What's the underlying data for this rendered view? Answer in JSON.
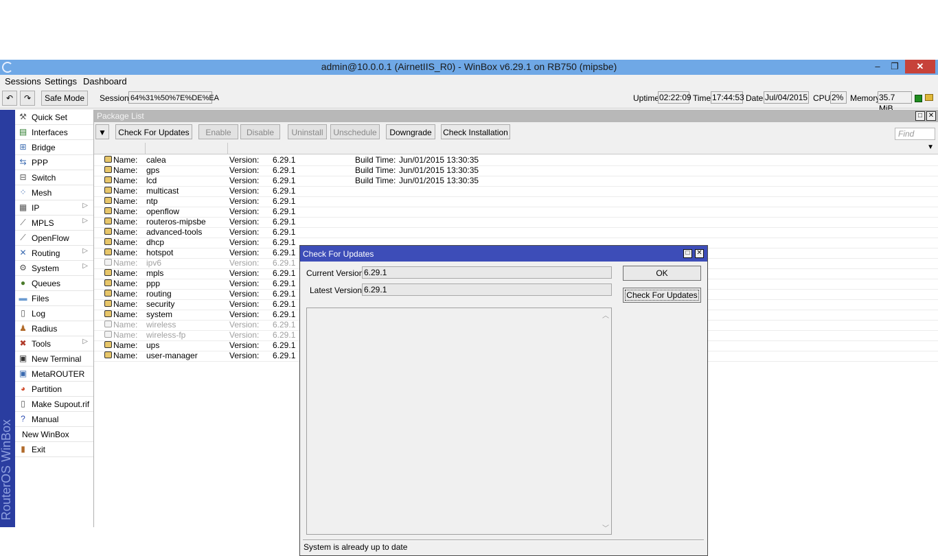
{
  "window": {
    "title": "admin@10.0.0.1 (AirnetIIS_R0) - WinBox v6.29.1 on RB750 (mipsbe)",
    "minimize": "–",
    "maximize": "❐",
    "close": "✕"
  },
  "menu": [
    "Sessions",
    "Settings",
    "Dashboard"
  ],
  "toolbar": {
    "undo": "↶",
    "redo": "↷",
    "safe_mode": "Safe Mode",
    "session_label": "Session:",
    "session_value": "64%31%50%7E%DE%EA",
    "uptime_label": "Uptime:",
    "uptime_value": "02:22:09",
    "time_label": "Time:",
    "time_value": "17:44:53",
    "date_label": "Date:",
    "date_value": "Jul/04/2015",
    "cpu_label": "CPU:",
    "cpu_value": "2%",
    "memory_label": "Memory:",
    "memory_value": "35.7 MiB"
  },
  "sidebar": {
    "brand": "RouterOS WinBox",
    "items": [
      {
        "label": "Quick Set",
        "icon": "quickset-icon"
      },
      {
        "label": "Interfaces",
        "icon": "interfaces-icon"
      },
      {
        "label": "Bridge",
        "icon": "bridge-icon"
      },
      {
        "label": "PPP",
        "icon": "ppp-icon"
      },
      {
        "label": "Switch",
        "icon": "switch-icon"
      },
      {
        "label": "Mesh",
        "icon": "mesh-icon"
      },
      {
        "label": "IP",
        "icon": "ip-icon",
        "submenu": true
      },
      {
        "label": "MPLS",
        "icon": "mpls-icon",
        "submenu": true
      },
      {
        "label": "OpenFlow",
        "icon": "openflow-icon"
      },
      {
        "label": "Routing",
        "icon": "routing-icon",
        "submenu": true
      },
      {
        "label": "System",
        "icon": "gear-icon",
        "submenu": true
      },
      {
        "label": "Queues",
        "icon": "queues-icon"
      },
      {
        "label": "Files",
        "icon": "folder-icon"
      },
      {
        "label": "Log",
        "icon": "log-icon"
      },
      {
        "label": "Radius",
        "icon": "radius-icon"
      },
      {
        "label": "Tools",
        "icon": "tools-icon",
        "submenu": true
      },
      {
        "label": "New Terminal",
        "icon": "terminal-icon"
      },
      {
        "label": "MetaROUTER",
        "icon": "metarouter-icon"
      },
      {
        "label": "Partition",
        "icon": "partition-icon"
      },
      {
        "label": "Make Supout.rif",
        "icon": "supout-icon"
      },
      {
        "label": "Manual",
        "icon": "help-icon"
      },
      {
        "label": "New WinBox",
        "icon": ""
      },
      {
        "label": "Exit",
        "icon": "exit-icon"
      }
    ]
  },
  "package_list": {
    "title": "Package List",
    "buttons": {
      "filter": "▼",
      "check_for_updates": "Check For Updates",
      "enable": "Enable",
      "disable": "Disable",
      "uninstall": "Uninstall",
      "unschedule": "Unschedule",
      "downgrade": "Downgrade",
      "check_installation": "Check Installation"
    },
    "find_placeholder": "Find",
    "name_label": "Name:",
    "version_label": "Version:",
    "build_label": "Build Time:",
    "rows": [
      {
        "name": "calea",
        "version": "6.29.1",
        "build": "Jun/01/2015 13:30:35",
        "disabled": false
      },
      {
        "name": "gps",
        "version": "6.29.1",
        "build": "Jun/01/2015 13:30:35",
        "disabled": false
      },
      {
        "name": "lcd",
        "version": "6.29.1",
        "build": "Jun/01/2015 13:30:35",
        "disabled": false
      },
      {
        "name": "multicast",
        "version": "6.29.1",
        "build": "",
        "disabled": false
      },
      {
        "name": "ntp",
        "version": "6.29.1",
        "build": "",
        "disabled": false
      },
      {
        "name": "openflow",
        "version": "6.29.1",
        "build": "",
        "disabled": false
      },
      {
        "name": "routeros-mipsbe",
        "version": "6.29.1",
        "build": "",
        "disabled": false
      },
      {
        "name": "advanced-tools",
        "version": "6.29.1",
        "build": "",
        "disabled": false
      },
      {
        "name": "dhcp",
        "version": "6.29.1",
        "build": "",
        "disabled": false
      },
      {
        "name": "hotspot",
        "version": "6.29.1",
        "build": "",
        "disabled": false
      },
      {
        "name": "ipv6",
        "version": "6.29.1",
        "build": "",
        "disabled": true
      },
      {
        "name": "mpls",
        "version": "6.29.1",
        "build": "",
        "disabled": false
      },
      {
        "name": "ppp",
        "version": "6.29.1",
        "build": "",
        "disabled": false
      },
      {
        "name": "routing",
        "version": "6.29.1",
        "build": "",
        "disabled": false
      },
      {
        "name": "security",
        "version": "6.29.1",
        "build": "",
        "disabled": false
      },
      {
        "name": "system",
        "version": "6.29.1",
        "build": "",
        "disabled": false
      },
      {
        "name": "wireless",
        "version": "6.29.1",
        "build": "",
        "disabled": true
      },
      {
        "name": "wireless-fp",
        "version": "6.29.1",
        "build": "",
        "disabled": true
      },
      {
        "name": "ups",
        "version": "6.29.1",
        "build": "",
        "disabled": false
      },
      {
        "name": "user-manager",
        "version": "6.29.1",
        "build": "",
        "disabled": false
      }
    ]
  },
  "dialog": {
    "title": "Check For Updates",
    "current_version_label": "Current Version:",
    "current_version": "6.29.1",
    "latest_version_label": "Latest Version:",
    "latest_version": "6.29.1",
    "ok": "OK",
    "check_for_updates": "Check For Updates",
    "status": "System is already up to date"
  },
  "colors": {
    "titlebar": "#6fa8e6",
    "sidebar_strip": "#2a3da0",
    "dialog_title": "#3d4db8",
    "close_button": "#c7423a"
  }
}
